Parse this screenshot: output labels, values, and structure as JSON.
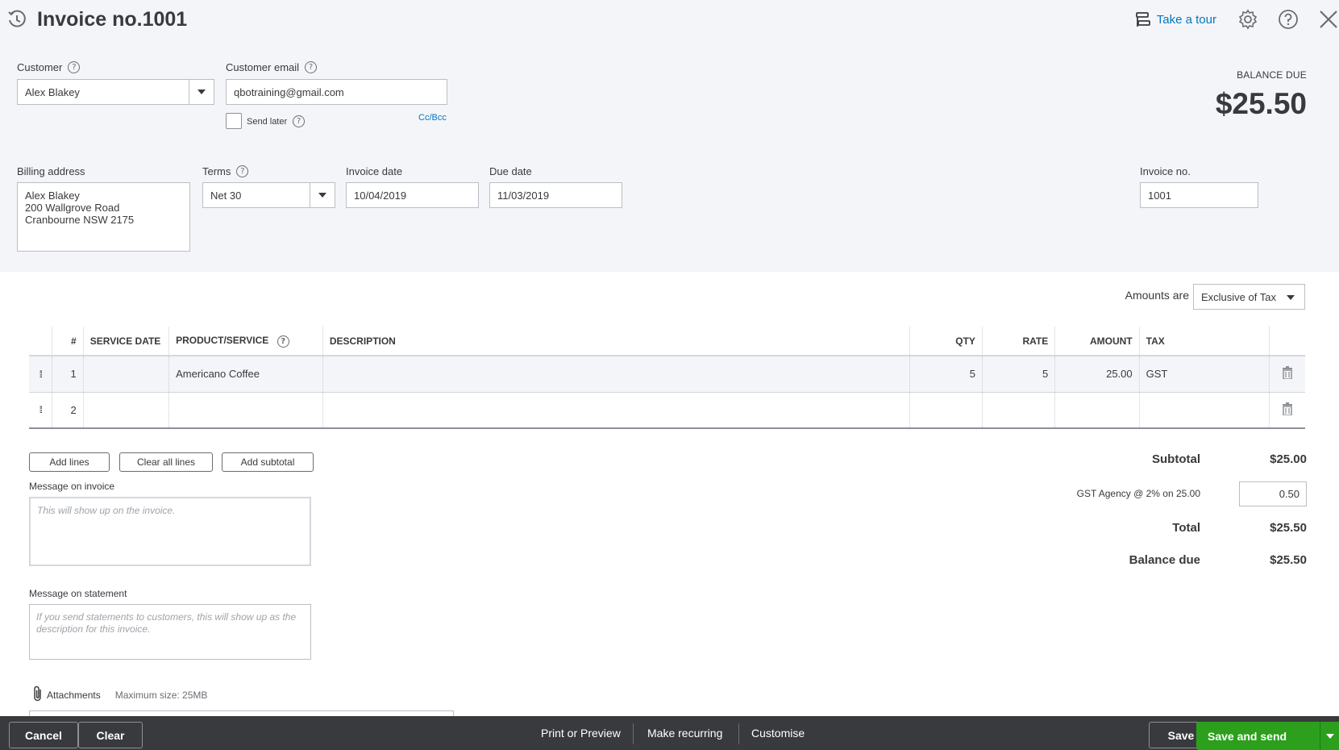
{
  "header": {
    "title": "Invoice no.1001",
    "take_tour": "Take a tour"
  },
  "customer": {
    "label": "Customer",
    "value": "Alex Blakey"
  },
  "email": {
    "label": "Customer email",
    "value": "qbotraining@gmail.com",
    "send_later": "Send later",
    "cc_bcc": "Cc/Bcc"
  },
  "balance": {
    "label": "BALANCE DUE",
    "amount": "$25.50"
  },
  "billing": {
    "label": "Billing address",
    "line1": "Alex Blakey",
    "line2": "200 Wallgrove Road",
    "line3": "Cranbourne NSW 2175"
  },
  "terms": {
    "label": "Terms",
    "value": "Net 30"
  },
  "invoice_date": {
    "label": "Invoice date",
    "value": "10/04/2019"
  },
  "due_date": {
    "label": "Due date",
    "value": "11/03/2019"
  },
  "invoice_no": {
    "label": "Invoice no.",
    "value": "1001"
  },
  "amounts": {
    "label": "Amounts are",
    "value": "Exclusive of Tax"
  },
  "table": {
    "headers": {
      "num": "#",
      "service_date": "SERVICE DATE",
      "product": "PRODUCT/SERVICE",
      "description": "DESCRIPTION",
      "qty": "QTY",
      "rate": "RATE",
      "amount": "AMOUNT",
      "tax": "TAX"
    },
    "rows": [
      {
        "num": "1",
        "service_date": "",
        "product": "Americano Coffee",
        "description": "",
        "qty": "5",
        "rate": "5",
        "amount": "25.00",
        "tax": "GST"
      },
      {
        "num": "2",
        "service_date": "",
        "product": "",
        "description": "",
        "qty": "",
        "rate": "",
        "amount": "",
        "tax": ""
      }
    ]
  },
  "line_buttons": {
    "add_lines": "Add lines",
    "clear_all": "Clear all lines",
    "add_subtotal": "Add subtotal"
  },
  "messages": {
    "invoice_label": "Message on invoice",
    "invoice_placeholder": "This will show up on the invoice.",
    "statement_label": "Message on statement",
    "statement_placeholder": "If you send statements to customers, this will show up as the description for this invoice."
  },
  "totals": {
    "subtotal_label": "Subtotal",
    "subtotal": "$25.00",
    "gst_label": "GST Agency @ 2% on 25.00",
    "gst_value": "0.50",
    "total_label": "Total",
    "total": "$25.50",
    "balance_label": "Balance due",
    "balance": "$25.50"
  },
  "attachments": {
    "label": "Attachments",
    "max_size": "Maximum size: 25MB"
  },
  "footer": {
    "cancel": "Cancel",
    "clear": "Clear",
    "print": "Print or Preview",
    "recurring": "Make recurring",
    "customise": "Customise",
    "save": "Save",
    "save_send": "Save and send"
  },
  "colors": {
    "accent": "#0077c5",
    "primary_button": "#2ca01c",
    "footer_bg": "#393a3d",
    "header_bg": "#f4f5f8"
  }
}
